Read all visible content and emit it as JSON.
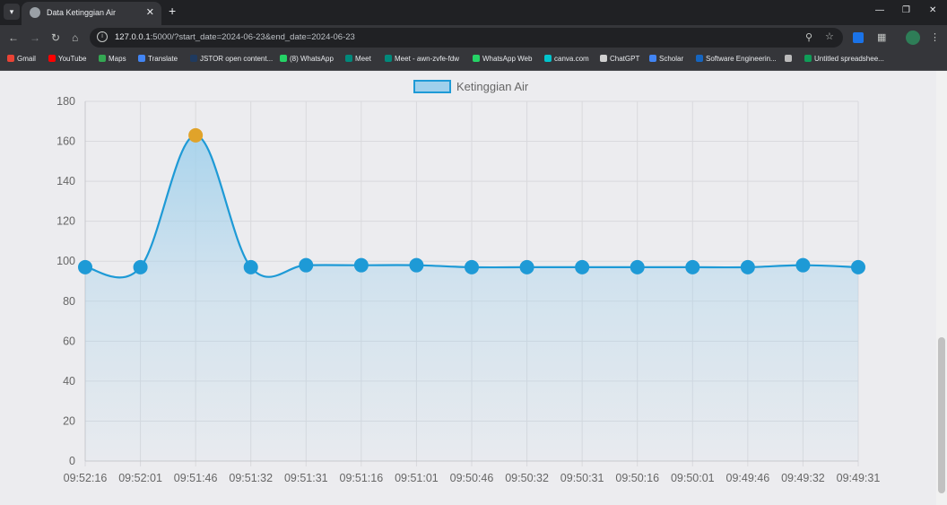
{
  "browser": {
    "tab_title": "Data Ketinggian Air",
    "url_host": "127.0.0.1",
    "url_rest": ":5000/?start_date=2024-06-23&end_date=2024-06-23",
    "bookmarks": [
      {
        "label": "Gmail",
        "color": "#ea4335"
      },
      {
        "label": "YouTube",
        "color": "#ff0000"
      },
      {
        "label": "Maps",
        "color": "#34a853"
      },
      {
        "label": "Translate",
        "color": "#4285f4"
      },
      {
        "label": "JSTOR open content...",
        "color": "#1f3a5f"
      },
      {
        "label": "(8) WhatsApp",
        "color": "#25d366"
      },
      {
        "label": "Meet",
        "color": "#00897b"
      },
      {
        "label": "Meet - awn-zvfe-fdw",
        "color": "#00897b"
      },
      {
        "label": "WhatsApp Web",
        "color": "#25d366"
      },
      {
        "label": "canva.com",
        "color": "#00c4cc"
      },
      {
        "label": "ChatGPT",
        "color": "#d0d0d0"
      },
      {
        "label": "Scholar",
        "color": "#4285f4"
      },
      {
        "label": "Software Engineerin...",
        "color": "#1565c0"
      },
      {
        "label": "",
        "color": "#bbbbbb"
      },
      {
        "label": "Untitled spreadshee...",
        "color": "#0f9d58"
      }
    ]
  },
  "chart_data": {
    "type": "line",
    "title": "",
    "legend": {
      "label": "Ketinggian Air",
      "position": "top-center"
    },
    "x": [
      "09:52:16",
      "09:52:01",
      "09:51:46",
      "09:51:32",
      "09:51:31",
      "09:51:16",
      "09:51:01",
      "09:50:46",
      "09:50:32",
      "09:50:31",
      "09:50:16",
      "09:50:01",
      "09:49:46",
      "09:49:32",
      "09:49:31"
    ],
    "series": [
      {
        "name": "Ketinggian Air",
        "values": [
          97,
          97,
          163,
          97,
          98,
          98,
          98,
          97,
          97,
          97,
          97,
          97,
          97,
          98,
          97
        ]
      }
    ],
    "highlighted_index": 2,
    "ylim": [
      0,
      180
    ],
    "yticks": [
      0,
      20,
      40,
      60,
      80,
      100,
      120,
      140,
      160,
      180
    ],
    "grid": true,
    "smooth": true,
    "fill": true,
    "colors": {
      "line": "#1e9ad6",
      "point": "#1e9ad6",
      "highlight": "#e0a32a",
      "fill_top": "#9fd0ec",
      "grid": "#d9d9dd",
      "text": "#666666"
    }
  }
}
